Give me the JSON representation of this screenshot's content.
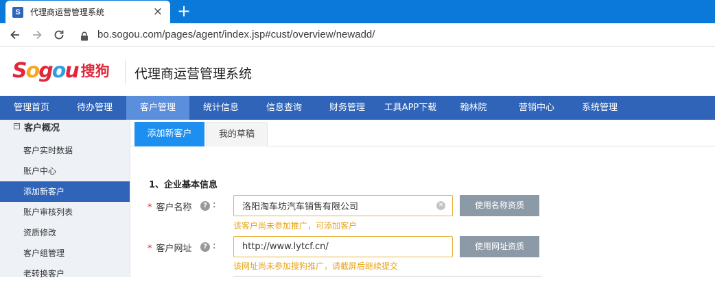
{
  "browser": {
    "tab_title": "代理商运营管理系统",
    "favicon_letter": "S",
    "url": "bo.sogou.com/pages/agent/index.jsp#cust/overview/newadd/"
  },
  "header": {
    "logo_letters": [
      "S",
      "o",
      "g",
      "o",
      "u"
    ],
    "logo_cn": "搜狗",
    "system_title": "代理商运营管理系统"
  },
  "colors": {
    "nav_bg": "#2f64b8",
    "nav_active": "#5b8fdc",
    "tab_active": "#1c8ff0",
    "warning_text": "#e8a317",
    "field_border": "#e8b340",
    "button_gray": "#8c99a6"
  },
  "mainnav": {
    "items": [
      {
        "label": "管理首页"
      },
      {
        "label": "待办管理"
      },
      {
        "label": "客户管理",
        "active": true
      },
      {
        "label": "统计信息"
      },
      {
        "label": "信息查询"
      },
      {
        "label": "财务管理"
      },
      {
        "label": "工具APP下载"
      },
      {
        "label": "翰林院"
      },
      {
        "label": "营销中心"
      },
      {
        "label": "系统管理"
      }
    ]
  },
  "sidebar": {
    "toggle_glyph": "⊟",
    "group_label": "客户概况",
    "items": [
      {
        "label": "客户实时数据"
      },
      {
        "label": "账户中心"
      },
      {
        "label": "添加新客户",
        "active": true
      },
      {
        "label": "账户审核列表"
      },
      {
        "label": "资质修改"
      },
      {
        "label": "客户组管理"
      },
      {
        "label": "老转换客户"
      }
    ]
  },
  "content": {
    "tabs": [
      {
        "label": "添加新客户",
        "active": true
      },
      {
        "label": "我的草稿"
      }
    ],
    "section_title": "1、企业基本信息",
    "form": {
      "required_mark": "*",
      "help_glyph": "?",
      "colon": ":",
      "customer_name": {
        "label": "客户名称",
        "value": "洛阳淘车坊汽车销售有限公司",
        "clear_glyph": "✕",
        "button": "使用名称资质",
        "hint": "该客户尚未参加推广，可添加客户"
      },
      "customer_url": {
        "label": "客户网址",
        "value": "http://www.lytcf.cn/",
        "button": "使用网址资质",
        "hint": "该网址尚未参加搜狗推广，请截屏后继续提交"
      }
    }
  }
}
